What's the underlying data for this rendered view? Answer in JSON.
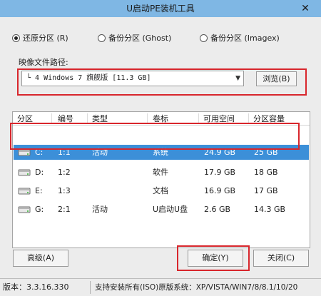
{
  "window": {
    "title": "U启动PE装机工具",
    "close_glyph": "✕"
  },
  "modes": [
    {
      "label": "还原分区 (R)",
      "checked": true
    },
    {
      "label": "备份分区 (Ghost)",
      "checked": false
    },
    {
      "label": "备份分区 (Imagex)",
      "checked": false
    }
  ],
  "image_path": {
    "label": "映像文件路径:",
    "selected": "└  4 Windows 7 旗舰版 [11.3 GB]",
    "browse_label": "浏览(B)"
  },
  "table": {
    "columns": [
      "分区",
      "编号",
      "类型",
      "卷标",
      "可用空间",
      "分区容量"
    ],
    "rows": [
      {
        "drive": "C:",
        "number": "1:1",
        "type": "活动",
        "label": "系统",
        "free": "24.9 GB",
        "capacity": "25 GB",
        "selected": true
      },
      {
        "drive": "D:",
        "number": "1:2",
        "type": "",
        "label": "软件",
        "free": "17.9 GB",
        "capacity": "18 GB",
        "selected": false
      },
      {
        "drive": "E:",
        "number": "1:3",
        "type": "",
        "label": "文档",
        "free": "16.9 GB",
        "capacity": "17 GB",
        "selected": false
      },
      {
        "drive": "G:",
        "number": "2:1",
        "type": "活动",
        "label": "U启动U盘",
        "free": "2.6 GB",
        "capacity": "14.3 GB",
        "selected": false
      }
    ]
  },
  "buttons": {
    "advanced": "高级(A)",
    "ok": "确定(Y)",
    "close": "关闭(C)"
  },
  "status": {
    "version": "版本：3.3.16.330",
    "systems": "支持安装所有(ISO)原版系统：XP/VISTA/WIN7/8/8.1/10/20"
  },
  "colors": {
    "titlebar": "#7fb7e4",
    "selection": "#3c8fd8",
    "highlight_box": "#d8262c"
  },
  "icons": {
    "drive": "hard-drive-icon",
    "dropdown": "chevron-down-icon",
    "close": "close-icon"
  }
}
